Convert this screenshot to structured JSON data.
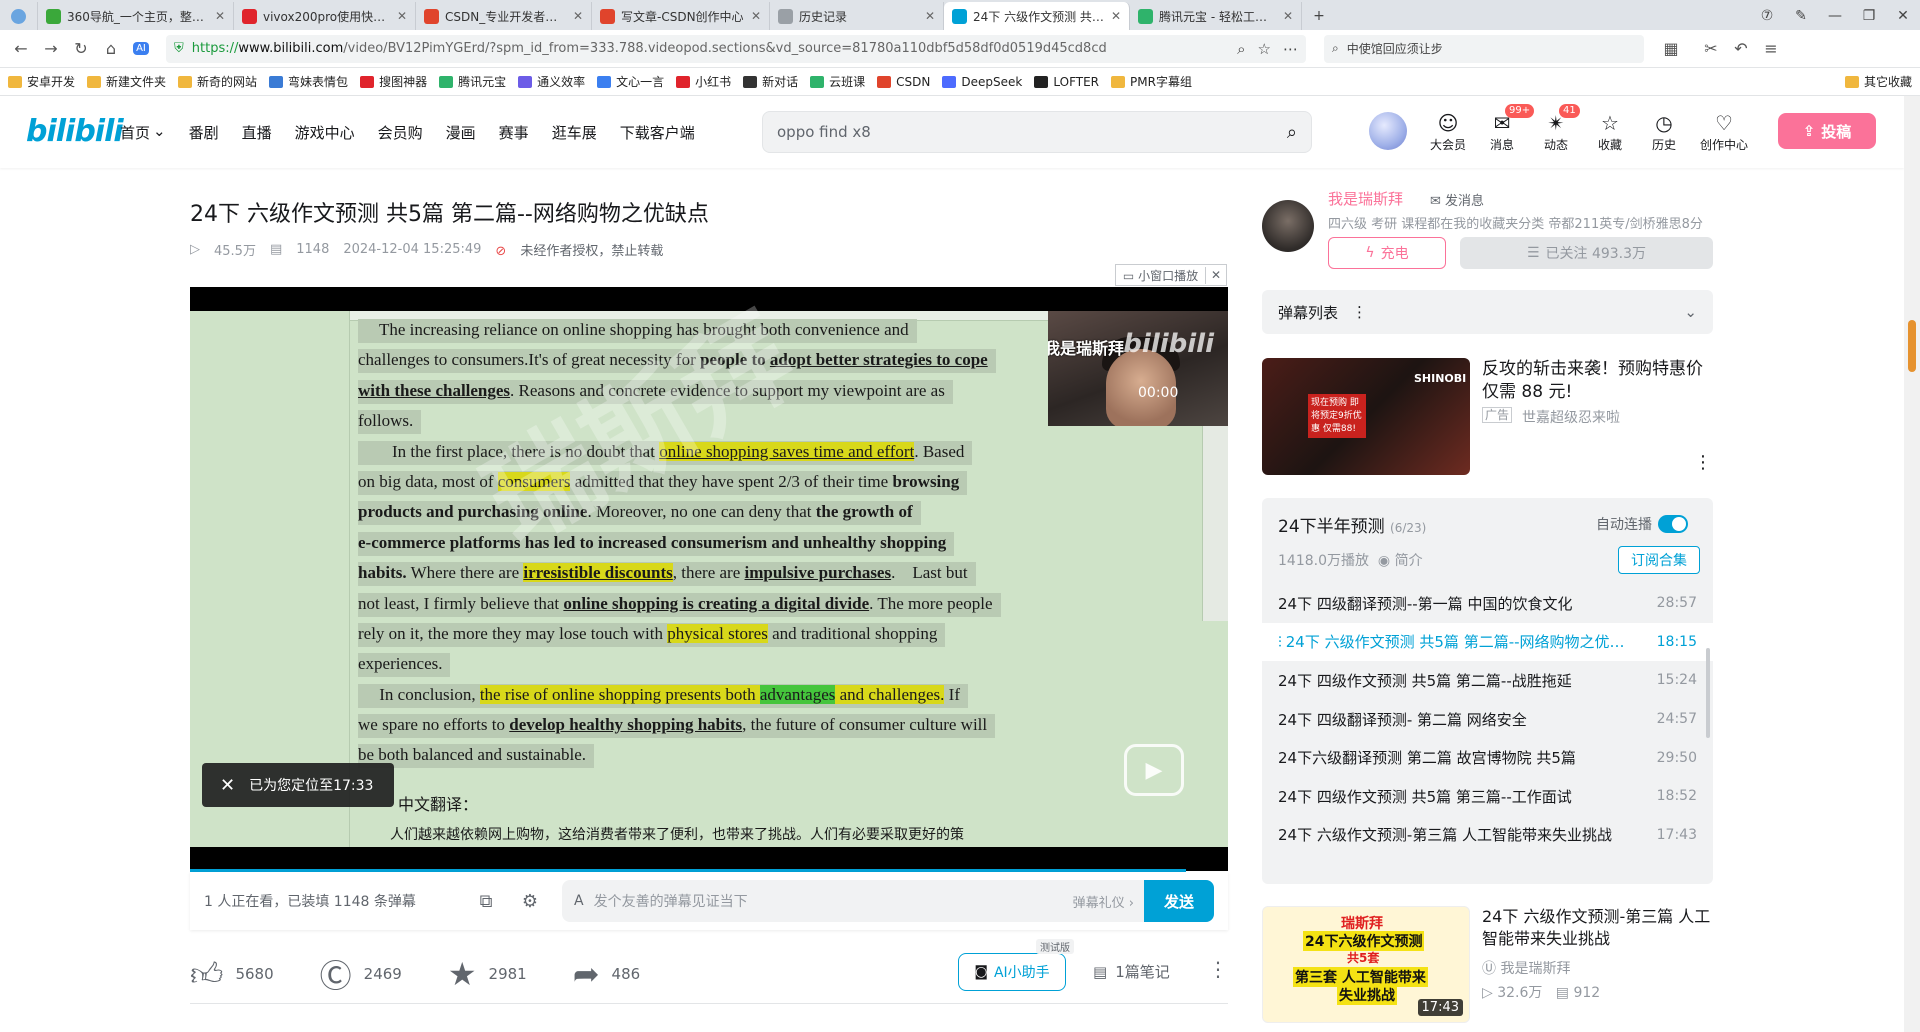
{
  "browser": {
    "tabs": [
      {
        "title": "360导航_一个主页，整个世界",
        "color": "#3aa83a",
        "active": false
      },
      {
        "title": "vivox200pro使用快半个月三",
        "color": "#e0242c",
        "active": false
      },
      {
        "title": "CSDN_专业开发者社区_已接",
        "color": "#e0442c",
        "active": false
      },
      {
        "title": "写文章-CSDN创作中心",
        "color": "#e0442c",
        "active": false
      },
      {
        "title": "历史记录",
        "color": "#9aa0a6",
        "active": false
      },
      {
        "title": "24下 六级作文预测 共5篇 第",
        "color": "#00a1d6",
        "active": true
      },
      {
        "title": "腾讯元宝 - 轻松工作 多点生活",
        "color": "#2fb36b",
        "active": false
      }
    ],
    "url_prefix": "https://",
    "url_domain": "www.bilibili.com",
    "url_rest": "/video/BV12PimYGErd/?spm_id_from=333.788.videopod.sections&vd_source=81780a110dbf5d58df0d0519d45cd8cd",
    "side_search": "中使馆回应须让步",
    "bookmarks": [
      "安卓开发",
      "新建文件夹",
      "新奇的网站",
      "弯妹表情包",
      "搜图神器",
      "腾讯元宝",
      "通义效率",
      "文心一言",
      "小红书",
      "新对话",
      "云班课",
      "CSDN",
      "DeepSeek",
      "LOFTER",
      "PMR字幕组"
    ],
    "other_bookmarks": "其它收藏"
  },
  "site": {
    "logo": "bilibili",
    "nav": [
      "首页",
      "番剧",
      "直播",
      "游戏中心",
      "会员购",
      "漫画",
      "赛事",
      "逛车展",
      "下载客户端"
    ],
    "search_value": "oppo find x8",
    "header_icons": [
      {
        "label": "大会员",
        "icon": "☺",
        "badge": ""
      },
      {
        "label": "消息",
        "icon": "✉",
        "badge": "99+"
      },
      {
        "label": "动态",
        "icon": "✴",
        "badge": "41"
      },
      {
        "label": "收藏",
        "icon": "☆",
        "badge": ""
      },
      {
        "label": "历史",
        "icon": "◷",
        "badge": ""
      },
      {
        "label": "创作中心",
        "icon": "♡",
        "badge": ""
      }
    ],
    "upload_label": "投稿"
  },
  "video": {
    "title": "24下 六级作文预测 共5篇 第二篇--网络购物之优缺点",
    "views": "45.5万",
    "danmaku": "1148",
    "date": "2024-12-04 15:25:49",
    "copyright": "未经作者授权，禁止转载",
    "mini_window": "小窗口播放",
    "toast": "已为您定位至17:33",
    "webcam_title": "我是瑞斯拜",
    "webcam_time": "00:00",
    "watermark": "瑞斯拜",
    "progress": 0.96,
    "cn_label": "中文翻译：",
    "cn_text": "人们越来越依赖网上购物，这给消费者带来了便利，也带来了挑战。人们有必要采取更好的策"
  },
  "essay_lines": [
    [
      {
        "t": "     The increasing reliance on online shopping has brought both convenience and"
      }
    ],
    [
      {
        "t": "challenges to consumers.It's of great necessity for "
      },
      {
        "t": "people to ",
        "c": "b"
      },
      {
        "t": "adopt better strategies to cope",
        "c": "b u"
      }
    ],
    [
      {
        "t": "with these challenges",
        "c": "b u"
      },
      {
        "t": ". Reasons and concrete evidence to support my viewpoint are as"
      }
    ],
    [
      {
        "t": "follows."
      }
    ],
    [
      {
        "t": "        In the first place, there is no doubt that "
      },
      {
        "t": "online shopping saves time and effort",
        "c": "u hl"
      },
      {
        "t": ". Based"
      }
    ],
    [
      {
        "t": "on big data, most of "
      },
      {
        "t": "consumers",
        "c": "hl"
      },
      {
        "t": " admitted that they have spent 2/3 of their time "
      },
      {
        "t": "browsing",
        "c": "b"
      }
    ],
    [
      {
        "t": "products and purchasing online",
        "c": "b"
      },
      {
        "t": ". Moreover, no one can deny that "
      },
      {
        "t": "the growth of",
        "c": "b"
      }
    ],
    [
      {
        "t": "e-commerce platforms has led to increased consumerism and unhealthy shopping",
        "c": "b"
      }
    ],
    [
      {
        "t": "habits.",
        "c": "b"
      },
      {
        "t": " Where there are "
      },
      {
        "t": "irresistible discounts",
        "c": "b u hl"
      },
      {
        "t": ", there are "
      },
      {
        "t": "impulsive purchases",
        "c": "b u"
      },
      {
        "t": ".    Last but"
      }
    ],
    [
      {
        "t": "not least, I firmly believe that "
      },
      {
        "t": "online shopping is creating a digital divide",
        "c": "b u"
      },
      {
        "t": ". The more people"
      }
    ],
    [
      {
        "t": "rely on it, the more they may lose touch with "
      },
      {
        "t": "physical stores",
        "c": "hl"
      },
      {
        "t": " and traditional shopping"
      }
    ],
    [
      {
        "t": "experiences."
      }
    ],
    [
      {
        "t": "     In conclusion, "
      },
      {
        "t": "the rise of online shopping presents both ",
        "c": "hl"
      },
      {
        "t": "advantages",
        "c": "hg"
      },
      {
        "t": " and challenges.",
        "c": "hl"
      },
      {
        "t": " If"
      }
    ],
    [
      {
        "t": "we spare no efforts to "
      },
      {
        "t": "develop healthy shopping habits",
        "c": "b u"
      },
      {
        "t": ", the future of consumer culture will"
      }
    ],
    [
      {
        "t": "be both balanced and sustainable."
      }
    ]
  ],
  "player_bar": {
    "watching": "1 人正在看，已装填 1148 条弹幕",
    "placeholder": "发个友善的弹幕见证当下",
    "etiquette": "弹幕礼仪 ›",
    "send": "发送"
  },
  "actions": {
    "like": "5680",
    "coin": "2469",
    "fav": "2981",
    "share": "486",
    "ai": "AI小助手",
    "ai_tag": "测试版",
    "notes": "1篇笔记"
  },
  "uploader": {
    "name": "我是瑞斯拜",
    "message": "发消息",
    "desc": "四六级 考研 课程都在我的收藏夹分类 帝都211英专/剑桥雅思8分",
    "charge": "充电",
    "followed": "已关注 493.3万"
  },
  "danmaku_list": {
    "label": "弹幕列表"
  },
  "ad": {
    "title": "反攻的斩击来袭！预购特惠价仅需 88 元!",
    "tag": "广告",
    "source": "世嘉超级忍来啦",
    "thumb_text": "现在预购 即将预定9折优惠 仅需88!",
    "brand": "SHINOBI"
  },
  "collection": {
    "title": "24下半年预测",
    "count": "(6/23)",
    "autoplay": "自动连播",
    "plays": "1418.0万播放",
    "intro": "简介",
    "subscribe": "订阅合集",
    "episodes": [
      {
        "title": "24下 四级翻译预测--第一篇 中国的饮食文化",
        "dur": "28:57",
        "cur": false
      },
      {
        "title": "24下 六级作文预测 共5篇 第二篇--网络购物之优缺点",
        "dur": "18:15",
        "cur": true
      },
      {
        "title": "24下 四级作文预测 共5篇 第二篇--战胜拖延",
        "dur": "15:24",
        "cur": false
      },
      {
        "title": "24下 四级翻译预测- 第二篇 网络安全",
        "dur": "24:57",
        "cur": false
      },
      {
        "title": "24下六级翻译预测 第二篇 故宫博物院 共5篇",
        "dur": "29:50",
        "cur": false
      },
      {
        "title": "24下 四级作文预测 共5篇 第三篇--工作面试",
        "dur": "18:52",
        "cur": false
      },
      {
        "title": "24下 六级作文预测-第三篇 人工智能带来失业挑战",
        "dur": "17:43",
        "cur": false
      }
    ]
  },
  "recommend": {
    "title": "24下 六级作文预测-第三篇 人工智能带来失业挑战",
    "up": "我是瑞斯拜",
    "views": "32.6万",
    "danmaku": "912",
    "duration": "17:43",
    "thumb_lines": [
      "瑞斯拜",
      "24下六级作文预测",
      "共5套",
      "第三套 人工智能带来",
      "失业挑战"
    ]
  },
  "colors": {
    "brand_blue": "#00a1d6",
    "brand_pink": "#fb7299",
    "doc_bg": "#cfe3c8",
    "highlight": "#d8d81a"
  }
}
